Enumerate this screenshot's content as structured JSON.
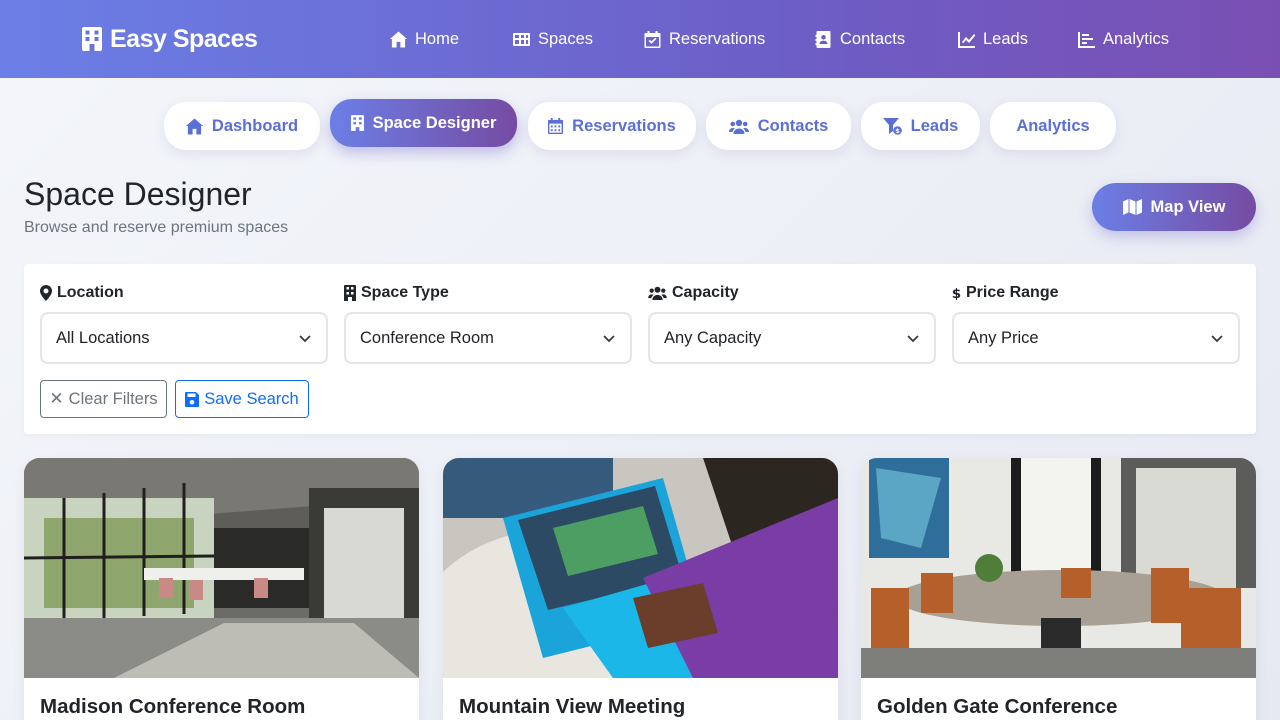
{
  "brand": {
    "name": "Easy Spaces"
  },
  "topnav": [
    {
      "label": "Home",
      "icon": "home-icon"
    },
    {
      "label": "Spaces",
      "icon": "table-icon"
    },
    {
      "label": "Reservations",
      "icon": "calendar-check-icon"
    },
    {
      "label": "Contacts",
      "icon": "address-book-icon"
    },
    {
      "label": "Leads",
      "icon": "chart-line-icon"
    },
    {
      "label": "Analytics",
      "icon": "chart-bar-icon"
    }
  ],
  "tabs": [
    {
      "label": "Dashboard",
      "icon": "home-icon"
    },
    {
      "label": "Space Designer",
      "icon": "building-icon",
      "active": true
    },
    {
      "label": "Reservations",
      "icon": "calendar-icon"
    },
    {
      "label": "Contacts",
      "icon": "users-icon"
    },
    {
      "label": "Leads",
      "icon": "funnel-dollar-icon"
    },
    {
      "label": "Analytics"
    }
  ],
  "page": {
    "title": "Space Designer",
    "subtitle": "Browse and reserve premium spaces",
    "map_button": "Map View"
  },
  "filters": {
    "location": {
      "label": "Location",
      "value": "All Locations"
    },
    "space_type": {
      "label": "Space Type",
      "value": "Conference Room"
    },
    "capacity": {
      "label": "Capacity",
      "value": "Any Capacity"
    },
    "price": {
      "label": "Price Range",
      "value": "Any Price"
    },
    "clear_label": "Clear Filters",
    "save_label": "Save Search"
  },
  "cards": [
    {
      "title": "Madison Conference Room"
    },
    {
      "title": "Mountain View Meeting"
    },
    {
      "title": "Golden Gate Conference"
    }
  ],
  "colors": {
    "accent": "#6b7fe6",
    "accent_dark": "#764ba2",
    "tab_text": "#5a6fd8",
    "save_blue": "#0d6efd"
  }
}
